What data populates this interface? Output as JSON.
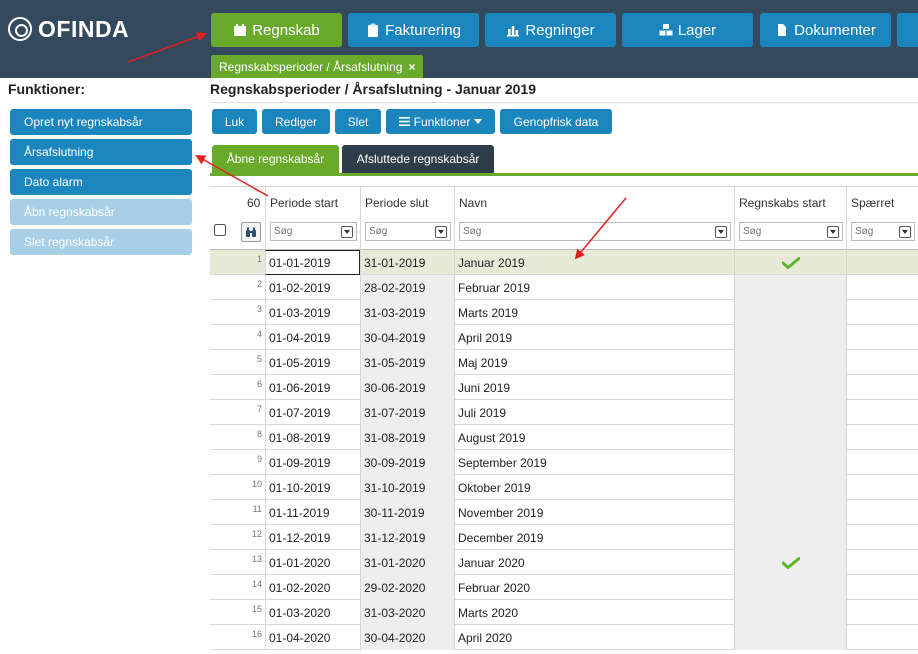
{
  "app": {
    "logo": "OFINDA"
  },
  "nav": [
    {
      "label": "Regnskab",
      "icon": "calendar-icon",
      "active": true
    },
    {
      "label": "Fakturering",
      "icon": "clipboard-icon",
      "active": false
    },
    {
      "label": "Regninger",
      "icon": "chart-icon",
      "active": false
    },
    {
      "label": "Lager",
      "icon": "cubes-icon",
      "active": false
    },
    {
      "label": "Dokumenter",
      "icon": "file-icon",
      "active": false
    }
  ],
  "breadcrumb_tab": {
    "label": "Regnskabsperioder / Årsafslutning",
    "close": "×"
  },
  "sidebar": {
    "title": "Funktioner:",
    "items": [
      {
        "label": "Opret nyt regnskabsår",
        "enabled": true
      },
      {
        "label": "Årsafslutning",
        "enabled": true
      },
      {
        "label": "Dato alarm",
        "enabled": true
      },
      {
        "label": "Åbn regnskabsår",
        "enabled": false
      },
      {
        "label": "Slet regnskabsår",
        "enabled": false
      }
    ]
  },
  "page": {
    "title": "Regnskabsperioder / Årsafslutning - Januar 2019"
  },
  "toolbar": {
    "luk": "Luk",
    "rediger": "Rediger",
    "slet": "Slet",
    "funktioner": "Funktioner",
    "genopfrisk": "Genopfrisk data"
  },
  "subtabs": {
    "open": "Åbne regnskabsår",
    "closed": "Afsluttede regnskabsår"
  },
  "grid": {
    "count": "60",
    "filter_placeholder": "Søg",
    "columns": [
      "Periode start",
      "Periode slut",
      "Navn",
      "Regnskabs start",
      "Spærret"
    ],
    "rows": [
      {
        "n": "1",
        "start": "01-01-2019",
        "end": "31-01-2019",
        "name": "Januar 2019",
        "regnskabs_start": true
      },
      {
        "n": "2",
        "start": "01-02-2019",
        "end": "28-02-2019",
        "name": "Februar 2019",
        "regnskabs_start": false
      },
      {
        "n": "3",
        "start": "01-03-2019",
        "end": "31-03-2019",
        "name": "Marts 2019",
        "regnskabs_start": false
      },
      {
        "n": "4",
        "start": "01-04-2019",
        "end": "30-04-2019",
        "name": "April 2019",
        "regnskabs_start": false
      },
      {
        "n": "5",
        "start": "01-05-2019",
        "end": "31-05-2019",
        "name": "Maj 2019",
        "regnskabs_start": false
      },
      {
        "n": "6",
        "start": "01-06-2019",
        "end": "30-06-2019",
        "name": "Juni 2019",
        "regnskabs_start": false
      },
      {
        "n": "7",
        "start": "01-07-2019",
        "end": "31-07-2019",
        "name": "Juli 2019",
        "regnskabs_start": false
      },
      {
        "n": "8",
        "start": "01-08-2019",
        "end": "31-08-2019",
        "name": "August 2019",
        "regnskabs_start": false
      },
      {
        "n": "9",
        "start": "01-09-2019",
        "end": "30-09-2019",
        "name": "September 2019",
        "regnskabs_start": false
      },
      {
        "n": "10",
        "start": "01-10-2019",
        "end": "31-10-2019",
        "name": "Oktober 2019",
        "regnskabs_start": false
      },
      {
        "n": "11",
        "start": "01-11-2019",
        "end": "30-11-2019",
        "name": "November 2019",
        "regnskabs_start": false
      },
      {
        "n": "12",
        "start": "01-12-2019",
        "end": "31-12-2019",
        "name": "December 2019",
        "regnskabs_start": false
      },
      {
        "n": "13",
        "start": "01-01-2020",
        "end": "31-01-2020",
        "name": "Januar 2020",
        "regnskabs_start": true
      },
      {
        "n": "14",
        "start": "01-02-2020",
        "end": "29-02-2020",
        "name": "Februar 2020",
        "regnskabs_start": false
      },
      {
        "n": "15",
        "start": "01-03-2020",
        "end": "31-03-2020",
        "name": "Marts 2020",
        "regnskabs_start": false
      },
      {
        "n": "16",
        "start": "01-04-2020",
        "end": "30-04-2020",
        "name": "April 2020",
        "regnskabs_start": false
      }
    ]
  },
  "colors": {
    "topbar": "#34495e",
    "accent_blue": "#1b86bd",
    "accent_green": "#6aaa2a",
    "annotation_red": "#e02020"
  }
}
